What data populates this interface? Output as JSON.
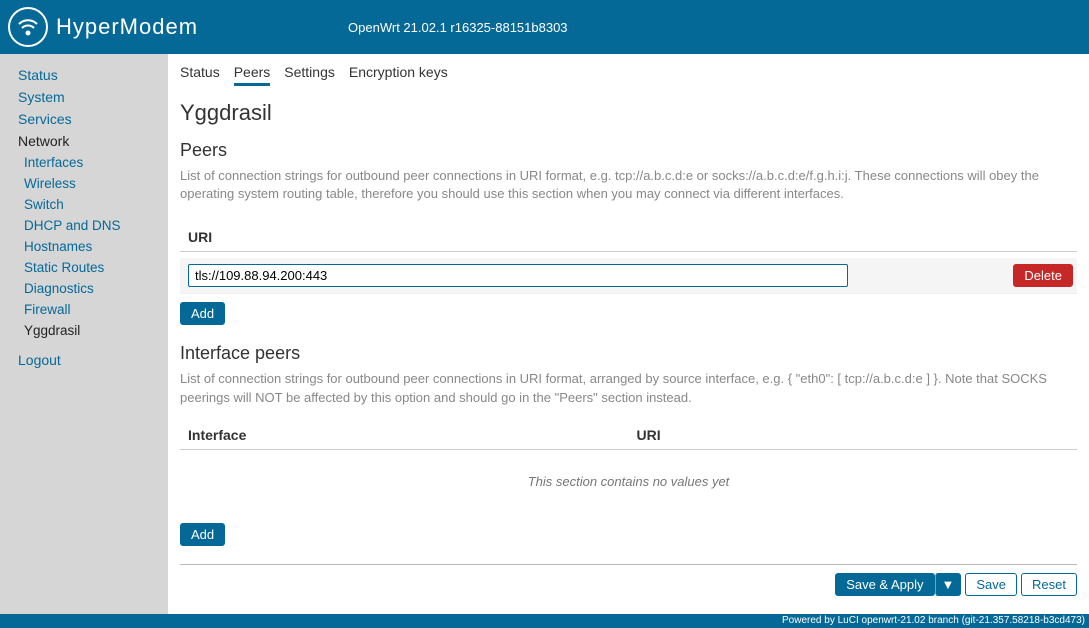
{
  "header": {
    "brand": "HyperModem",
    "fw_string": "OpenWrt 21.02.1 r16325-88151b8303"
  },
  "sidebar": {
    "top": [
      {
        "label": "Status",
        "active": false
      },
      {
        "label": "System",
        "active": false
      },
      {
        "label": "Services",
        "active": false
      },
      {
        "label": "Network",
        "active": true
      }
    ],
    "network_sub": [
      {
        "label": "Interfaces",
        "active": false
      },
      {
        "label": "Wireless",
        "active": false
      },
      {
        "label": "Switch",
        "active": false
      },
      {
        "label": "DHCP and DNS",
        "active": false
      },
      {
        "label": "Hostnames",
        "active": false
      },
      {
        "label": "Static Routes",
        "active": false
      },
      {
        "label": "Diagnostics",
        "active": false
      },
      {
        "label": "Firewall",
        "active": false
      },
      {
        "label": "Yggdrasil",
        "active": true
      }
    ],
    "logout": "Logout"
  },
  "tabs": [
    {
      "label": "Status",
      "active": false
    },
    {
      "label": "Peers",
      "active": true
    },
    {
      "label": "Settings",
      "active": false
    },
    {
      "label": "Encryption keys",
      "active": false
    }
  ],
  "page_title": "Yggdrasil",
  "peers": {
    "title": "Peers",
    "desc": "List of connection strings for outbound peer connections in URI format, e.g. tcp://a.b.c.d:e or socks://a.b.c.d:e/f.g.h.i:j. These connections will obey the operating system routing table, therefore you should use this section when you may connect via different interfaces.",
    "col_uri": "URI",
    "rows": [
      {
        "uri": "tls://109.88.94.200:443"
      }
    ],
    "delete_label": "Delete",
    "add_label": "Add"
  },
  "iface_peers": {
    "title": "Interface peers",
    "desc": "List of connection strings for outbound peer connections in URI format, arranged by source interface, e.g. { \"eth0\": [ tcp://a.b.c.d:e ] }. Note that SOCKS peerings will NOT be affected by this option and should go in the \"Peers\" section instead.",
    "col_iface": "Interface",
    "col_uri": "URI",
    "empty": "This section contains no values yet",
    "add_label": "Add"
  },
  "actions": {
    "save_apply": "Save & Apply",
    "dropdown": "▼",
    "save": "Save",
    "reset": "Reset"
  },
  "footer": "Powered by LuCI openwrt-21.02 branch (git-21.357.58218-b3cd473)"
}
